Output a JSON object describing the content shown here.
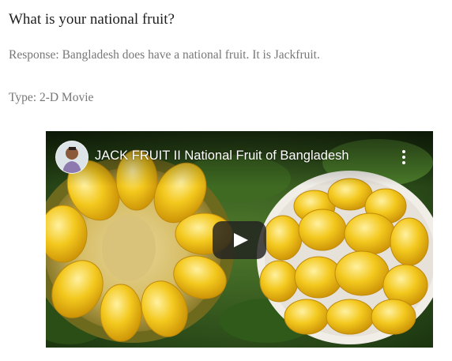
{
  "question": "What is your national fruit?",
  "response": "Response: Bangladesh does have a national fruit. It is Jackfruit.",
  "type": "Type: 2-D Movie",
  "video": {
    "title": "JACK FRUIT II National Fruit of Bangladesh",
    "channel_avatar_icon": "channel-avatar",
    "menu_icon": "more-vert-icon",
    "play_icon": "play-icon"
  },
  "colors": {
    "question_text": "#1f1f1f",
    "secondary_text": "#777777",
    "fruit_yellow": "#f2c21b",
    "play_button_bg": "#212121"
  }
}
